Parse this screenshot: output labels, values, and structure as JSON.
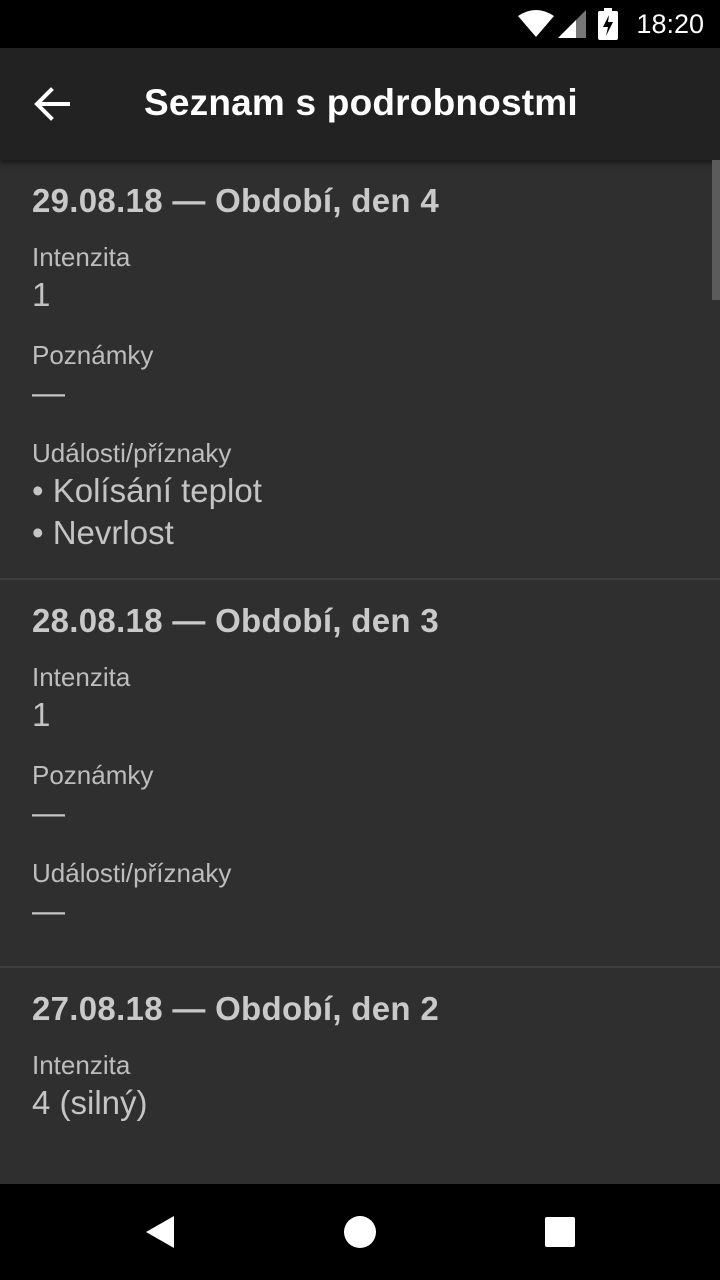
{
  "status_bar": {
    "time": "18:20",
    "icons": [
      "wifi-icon",
      "cell-signal-icon",
      "battery-charging-icon"
    ]
  },
  "app_bar": {
    "title": "Seznam s podrobnostmi",
    "back_icon": "arrow-back-icon"
  },
  "entries": [
    {
      "title": "29.08.18 — Období, den 4",
      "intensity_label": "Intenzita",
      "intensity_value": "1",
      "notes_label": "Poznámky",
      "notes_value": "—",
      "events_label": "Události/příznaky",
      "events": [
        "• Kolísání teplot",
        "• Nevrlost"
      ]
    },
    {
      "title": "28.08.18 — Období, den 3",
      "intensity_label": "Intenzita",
      "intensity_value": "1",
      "notes_label": "Poznámky",
      "notes_value": "—",
      "events_label": "Události/příznaky",
      "events": [
        "—"
      ]
    },
    {
      "title": "27.08.18 — Období, den 2",
      "intensity_label": "Intenzita",
      "intensity_value": "4 (silný)"
    }
  ],
  "nav_bar": {
    "icons": [
      "back-triangle-icon",
      "home-circle-icon",
      "recents-square-icon"
    ]
  },
  "colors": {
    "status_bar": "#000000",
    "app_bar": "#222222",
    "content_bg": "#2f2f2f",
    "divider": "#3e3e3e",
    "text_primary": "#c9c9c9"
  }
}
